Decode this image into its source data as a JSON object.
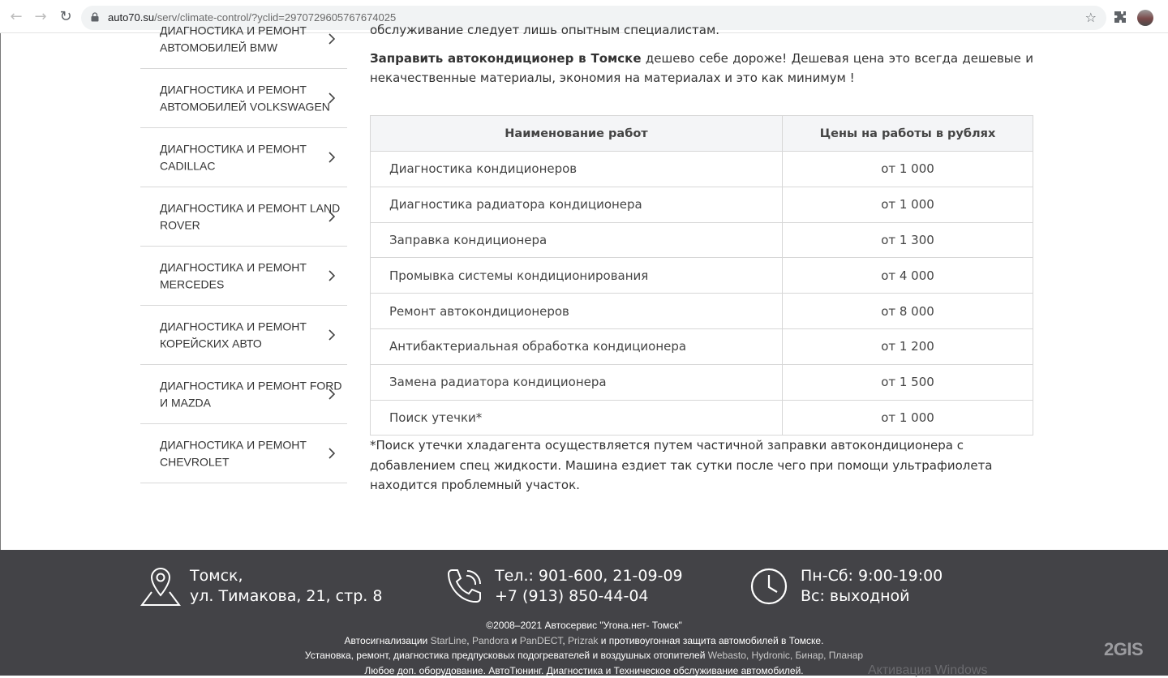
{
  "browser": {
    "url_host": "auto70.su",
    "url_path": "/serv/climate-control/?yclid=2970729605767674025"
  },
  "sidebar": {
    "items": [
      {
        "label": "ДИАГНОСТИКА И РЕМОНТ АВТОМОБИЛЕЙ BMW"
      },
      {
        "label": "ДИАГНОСТИКА И РЕМОНТ АВТОМОБИЛЕЙ VOLKSWAGEN"
      },
      {
        "label": "ДИАГНОСТИКА И РЕМОНТ CADILLAC"
      },
      {
        "label": "ДИАГНОСТИКА И РЕМОНТ LAND ROVER"
      },
      {
        "label": "ДИАГНОСТИКА И РЕМОНТ MERCEDES"
      },
      {
        "label": "ДИАГНОСТИКА И РЕМОНТ КОРЕЙСКИХ АВТО"
      },
      {
        "label": "ДИАГНОСТИКА И РЕМОНТ FORD И MAZDA"
      },
      {
        "label": "ДИАГНОСТИКА И РЕМОНТ CHEVROLET"
      }
    ]
  },
  "main": {
    "top_line": "обслуживание следует лишь опытным специалистам.",
    "intro_bold": "Заправить автокондиционер в Томске",
    "intro_rest": " дешево себе дороже! Дешевая цена это всегда дешевые и некачественные материалы, экономия на материалах и это как минимум !",
    "table": {
      "headers": [
        "Наименование работ",
        "Цены на работы в рублях"
      ],
      "rows": [
        {
          "name": "Диагностика кондиционеров",
          "price": "от 1 000"
        },
        {
          "name": "Диагностика радиатора кондиционера",
          "price": "от 1 000"
        },
        {
          "name": "Заправка кондиционера",
          "price": "от 1 300"
        },
        {
          "name": "Промывка системы кондиционирования",
          "price": "от 4 000"
        },
        {
          "name": "Ремонт автокондиционеров",
          "price": "от 8 000"
        },
        {
          "name": "Антибактериальная обработка кондиционера",
          "price": "от 1 200"
        },
        {
          "name": "Замена радиатора кондиционера",
          "price": "от 1 500"
        },
        {
          "name": "Поиск утечки*",
          "price": "от 1 000"
        }
      ]
    },
    "note": "*Поиск утечки хладагента осуществляется путем частичной заправки автокондиционера с добавлением спец жидкости. Машина ездиет так сутки после чего при помощи ультрафиолета находится проблемный участок."
  },
  "footer": {
    "address_line1": "Томск,",
    "address_line2": "ул. Тимакова, 21, стр. 8",
    "phone_line1": "Тел.: 901-600, 21-09-09",
    "phone_line2": "+7 (913) 850-44-04",
    "hours_line1": "Пн-Сб: 9:00-19:00",
    "hours_line2": "Вс: выходной",
    "copyright": "©2008–2021 Автосервис \"Угона.нет- Томск\"",
    "line2_a": "Автосигнализации ",
    "line2_starline": "StarLine",
    "line2_b": ", ",
    "line2_pandora": "Pandora",
    "line2_c": " и ",
    "line2_pandect": "PanDECT",
    "line2_d": ", ",
    "line2_prizrak": "Prizrak",
    "line2_e": " и противоугонная защита автомобилей в Томске.",
    "line3_a": "Установка, ремонт, диагностика предпусковых подогревателей и воздушных отопителей ",
    "line3_links": "Webasto, Hydronic, Бинар, Планар",
    "line4": "Любое доп. оборудование. АвтоТюнинг. Диагностика и Техническое обслуживание автомобилей.",
    "twogis": "2GIS",
    "watermark": "Активация Windows"
  },
  "colors": {
    "footer_bg": "#434347",
    "table_header_bg": "#f4f5f7",
    "border": "#d7d7d7"
  }
}
